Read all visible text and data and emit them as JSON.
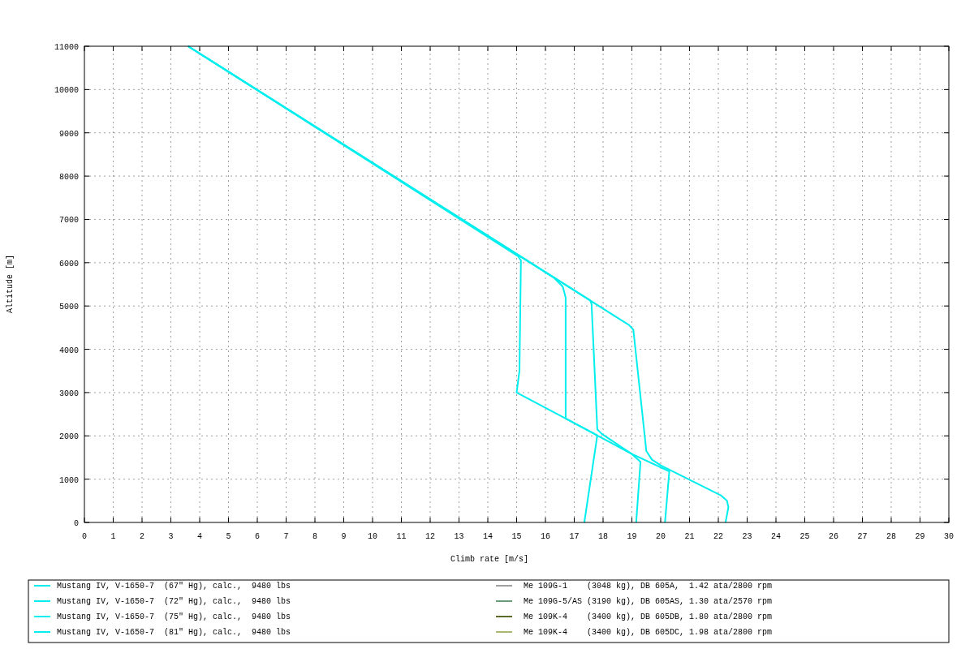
{
  "chart_data": {
    "type": "line",
    "grid": true,
    "legend": "bottom",
    "xlabel": "Climb rate [m/s]",
    "ylabel": "Altitude [m]",
    "xlim": [
      0,
      30
    ],
    "ylim": [
      0,
      11000
    ],
    "xticks": [
      0,
      1,
      2,
      3,
      4,
      5,
      6,
      7,
      8,
      9,
      10,
      11,
      12,
      13,
      14,
      15,
      16,
      17,
      18,
      19,
      20,
      21,
      22,
      23,
      24,
      25,
      26,
      27,
      28,
      29,
      30
    ],
    "yticks": [
      0,
      1000,
      2000,
      3000,
      4000,
      5000,
      6000,
      7000,
      8000,
      9000,
      10000,
      11000
    ],
    "series": [
      {
        "name": "Mustang IV, V-1650-7  (67\" Hg), calc.,  9480 lbs",
        "color": "#00eeee",
        "x": [
          3.6,
          15.05,
          15.15,
          15.1,
          15.0,
          16.7,
          17.8,
          17.35
        ],
        "values": [
          11000,
          6150,
          6050,
          3500,
          3000,
          2400,
          2010,
          0
        ]
      },
      {
        "name": "Mustang IV, V-1650-7  (72\" Hg), calc.,  9480 lbs",
        "color": "#00eeee",
        "x": [
          3.6,
          16.3,
          16.6,
          16.7,
          16.7,
          19.0,
          19.3,
          19.15
        ],
        "values": [
          11000,
          5650,
          5450,
          5200,
          2400,
          1580,
          1400,
          0
        ]
      },
      {
        "name": "Mustang IV, V-1650-7  (75\" Hg), calc.,  9480 lbs",
        "color": "#00eeee",
        "x": [
          3.6,
          17.55,
          17.6,
          17.8,
          17.95,
          19.0,
          20.3,
          20.15
        ],
        "values": [
          11000,
          5130,
          5050,
          2150,
          2050,
          1580,
          1180,
          0
        ]
      },
      {
        "name": "Mustang IV, V-1650-7  (81\" Hg), calc.,  9480 lbs",
        "color": "#00eeee",
        "x": [
          3.6,
          18.9,
          19.05,
          19.5,
          19.7,
          20.0,
          22.1,
          22.3,
          22.35,
          22.25
        ],
        "values": [
          11000,
          4560,
          4450,
          1650,
          1450,
          1320,
          620,
          500,
          350,
          0
        ]
      },
      {
        "name": "Me 109G-1    (3048 kg), DB 605A,  1.42 ata/2800 rpm",
        "color": "#a0a0a0"
      },
      {
        "name": "Me 109G-5/AS (3190 kg), DB 605AS, 1.30 ata/2570 rpm",
        "color": "#6a9a78"
      },
      {
        "name": "Me 109K-4    (3400 kg), DB 605DB, 1.80 ata/2800 rpm",
        "color": "#5a6a2a"
      },
      {
        "name": "Me 109K-4    (3400 kg), DB 605DC, 1.98 ata/2800 rpm",
        "color": "#a8b870"
      }
    ]
  }
}
